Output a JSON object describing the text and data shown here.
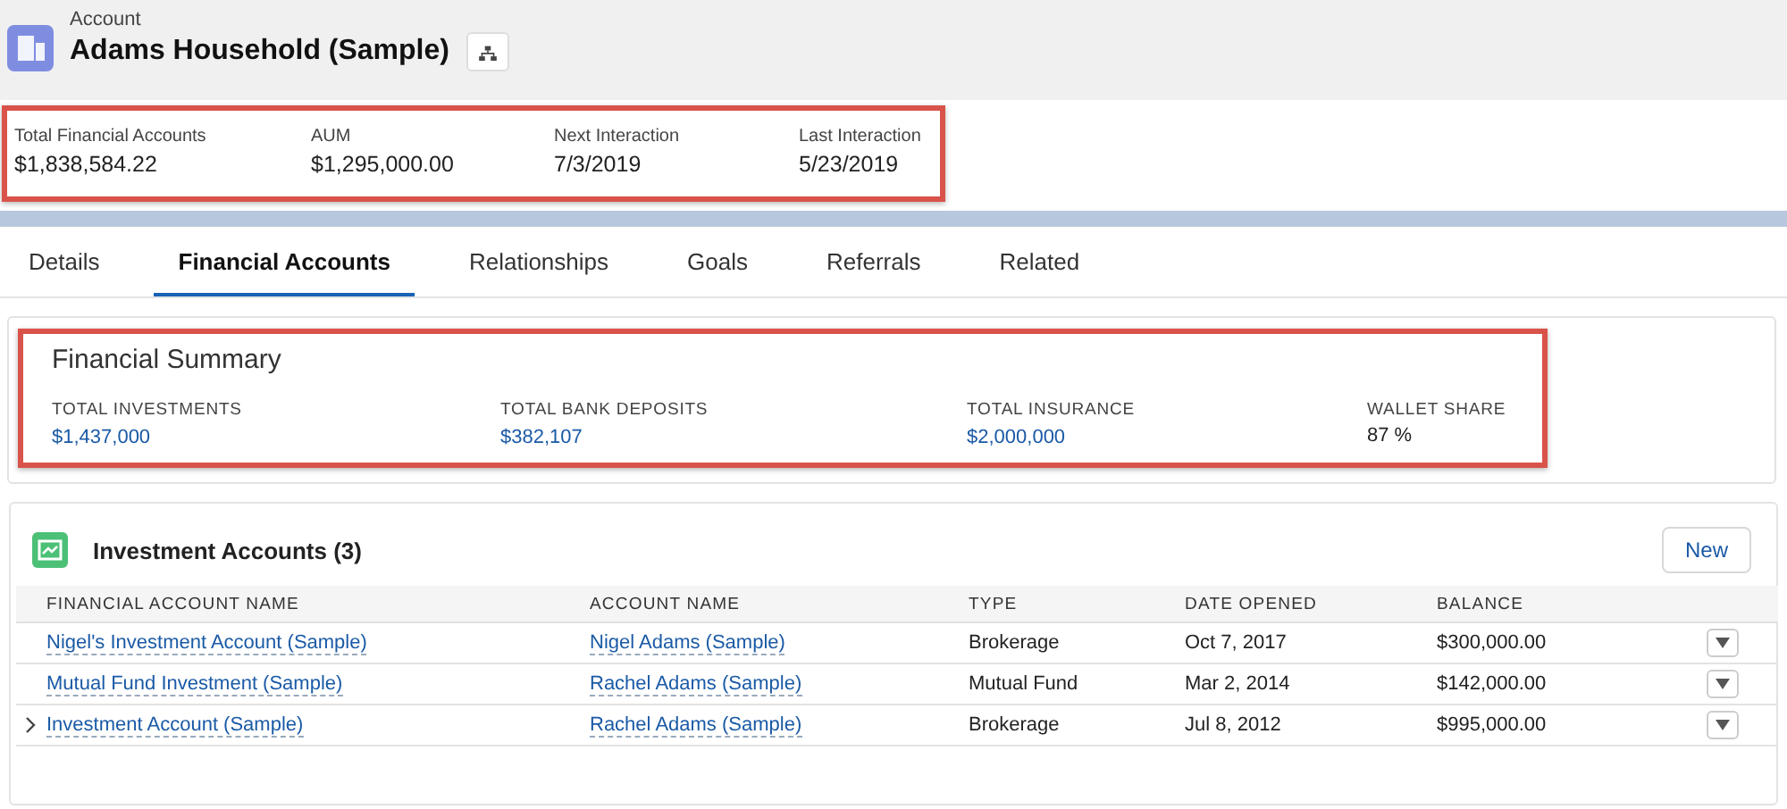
{
  "header": {
    "object_type": "Account",
    "title": "Adams Household (Sample)"
  },
  "highlights": [
    {
      "label": "Total Financial Accounts",
      "value": "$1,838,584.22"
    },
    {
      "label": "AUM",
      "value": "$1,295,000.00"
    },
    {
      "label": "Next Interaction",
      "value": "7/3/2019"
    },
    {
      "label": "Last Interaction",
      "value": "5/23/2019"
    }
  ],
  "tabs": [
    {
      "label": "Details",
      "selected": false
    },
    {
      "label": "Financial Accounts",
      "selected": true
    },
    {
      "label": "Relationships",
      "selected": false
    },
    {
      "label": "Goals",
      "selected": false
    },
    {
      "label": "Referrals",
      "selected": false
    },
    {
      "label": "Related",
      "selected": false
    }
  ],
  "financial_summary": {
    "title": "Financial Summary",
    "items": [
      {
        "label": "TOTAL INVESTMENTS",
        "value": "$1,437,000",
        "kind": "link"
      },
      {
        "label": "TOTAL BANK DEPOSITS",
        "value": "$382,107",
        "kind": "link"
      },
      {
        "label": "TOTAL INSURANCE",
        "value": "$2,000,000",
        "kind": "link"
      },
      {
        "label": "WALLET SHARE",
        "value": "87 %",
        "kind": "plain"
      }
    ]
  },
  "investment_accounts": {
    "title": "Investment Accounts (3)",
    "new_button": "New",
    "columns": [
      "FINANCIAL ACCOUNT NAME",
      "ACCOUNT NAME",
      "TYPE",
      "DATE OPENED",
      "BALANCE"
    ],
    "rows": [
      {
        "expandable": false,
        "cells": [
          "Nigel's Investment Account (Sample)",
          "Nigel Adams (Sample)",
          "Brokerage",
          "Oct 7, 2017",
          "$300,000.00"
        ]
      },
      {
        "expandable": false,
        "cells": [
          "Mutual Fund Investment (Sample)",
          "Rachel Adams (Sample)",
          "Mutual Fund",
          "Mar 2, 2014",
          "$142,000.00"
        ]
      },
      {
        "expandable": true,
        "cells": [
          "Investment Account (Sample)",
          "Rachel Adams (Sample)",
          "Brokerage",
          "Jul 8, 2012",
          "$995,000.00"
        ]
      }
    ]
  }
}
